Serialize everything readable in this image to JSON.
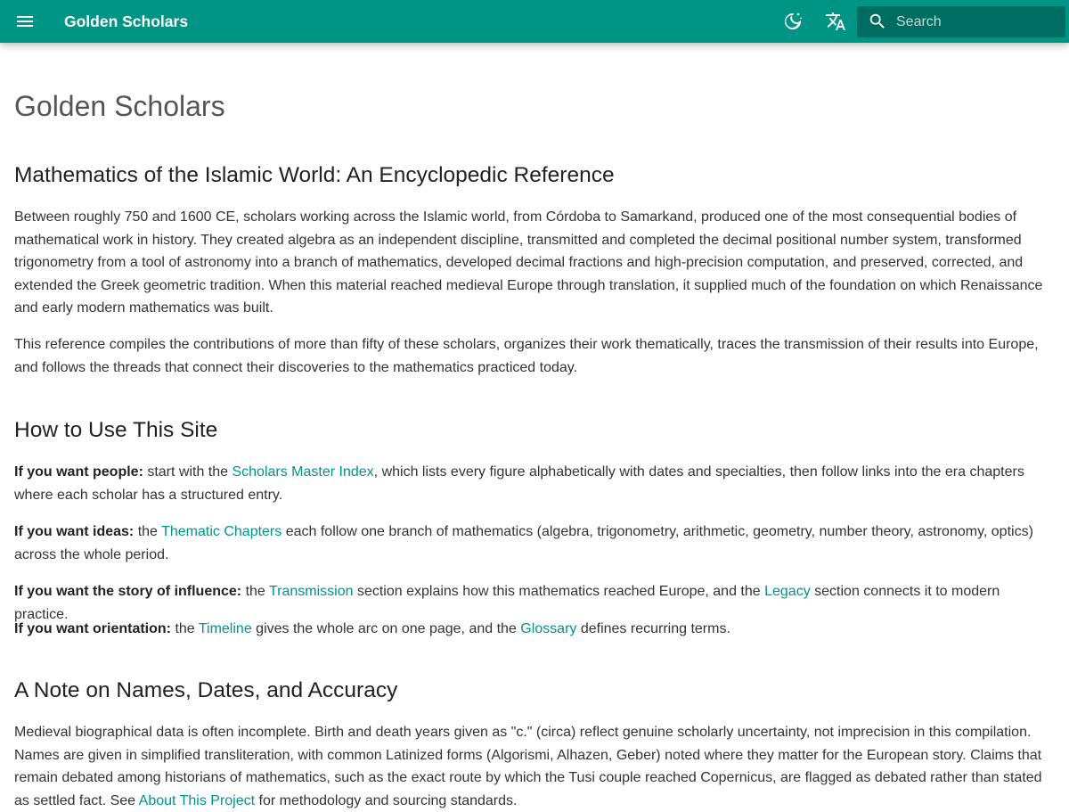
{
  "header": {
    "site_title": "Golden Scholars",
    "search_placeholder": "Search",
    "color": "#009485"
  },
  "page": {
    "title": "Golden Scholars",
    "section1": {
      "heading": "Mathematics of the Islamic World: An Encyclopedic Reference",
      "para1": "Between roughly 750 and 1600 CE, scholars working across the Islamic world, from Córdoba to Samarkand, produced one of the most consequential bodies of mathematical work in history. They created algebra as an independent discipline, transmitted and completed the decimal positional number system, transformed trigonometry from a tool of astronomy into a branch of mathematics, developed decimal fractions and high-precision computation, and preserved, corrected, and extended the Greek geometric tradition. When this material reached medieval Europe through translation, it supplied much of the foundation on which Renaissance and early modern mathematics was built.",
      "para2": "This reference compiles the contributions of more than fifty of these scholars, organizes their work thematically, traces the transmission of their results into Europe, and follows the threads that connect their discoveries to the mathematics practiced today."
    },
    "section2": {
      "heading": "How to Use This Site",
      "people": {
        "label": "If you want people:",
        "text1": " start with the ",
        "link": "Scholars Master Index",
        "text2": ", which lists every figure alphabetically with dates and specialties, then follow links into the era chapters where each scholar has a structured entry."
      },
      "ideas": {
        "label": "If you want ideas:",
        "text1": " the ",
        "link": "Thematic Chapters",
        "text2": " each follow one branch of mathematics (algebra, trigonometry, arithmetic, geometry, number theory, astronomy, optics) across the whole period."
      },
      "influence": {
        "label": "If you want the story of influence:",
        "text1": " the ",
        "link1": "Transmission",
        "text2": " section explains how this mathematics reached Europe, and the ",
        "link2": "Legacy",
        "text3": " section connects it to modern practice."
      },
      "orientation": {
        "label": "If you want orientation:",
        "text1": " the ",
        "link1": "Timeline",
        "text2": " gives the whole arc on one page, and the ",
        "link2": "Glossary",
        "text3": " defines recurring terms."
      }
    },
    "section3": {
      "heading": "A Note on Names, Dates, and Accuracy",
      "text1": "Medieval biographical data is often incomplete. Birth and death years given as \"c.\" (circa) reflect genuine scholarly uncertainty, not imprecision in this compilation. Names are given in simplified transliteration, with common Latinized forms (Algorismi, Alhazen, Geber) noted where they matter for the European story. Claims that remain debated among historians of mathematics, such as the exact route by which the Tusi couple reached Copernicus, are flagged as debated rather than stated as settled fact. See ",
      "link": "About This Project",
      "text2": " for methodology and sourcing standards."
    }
  }
}
